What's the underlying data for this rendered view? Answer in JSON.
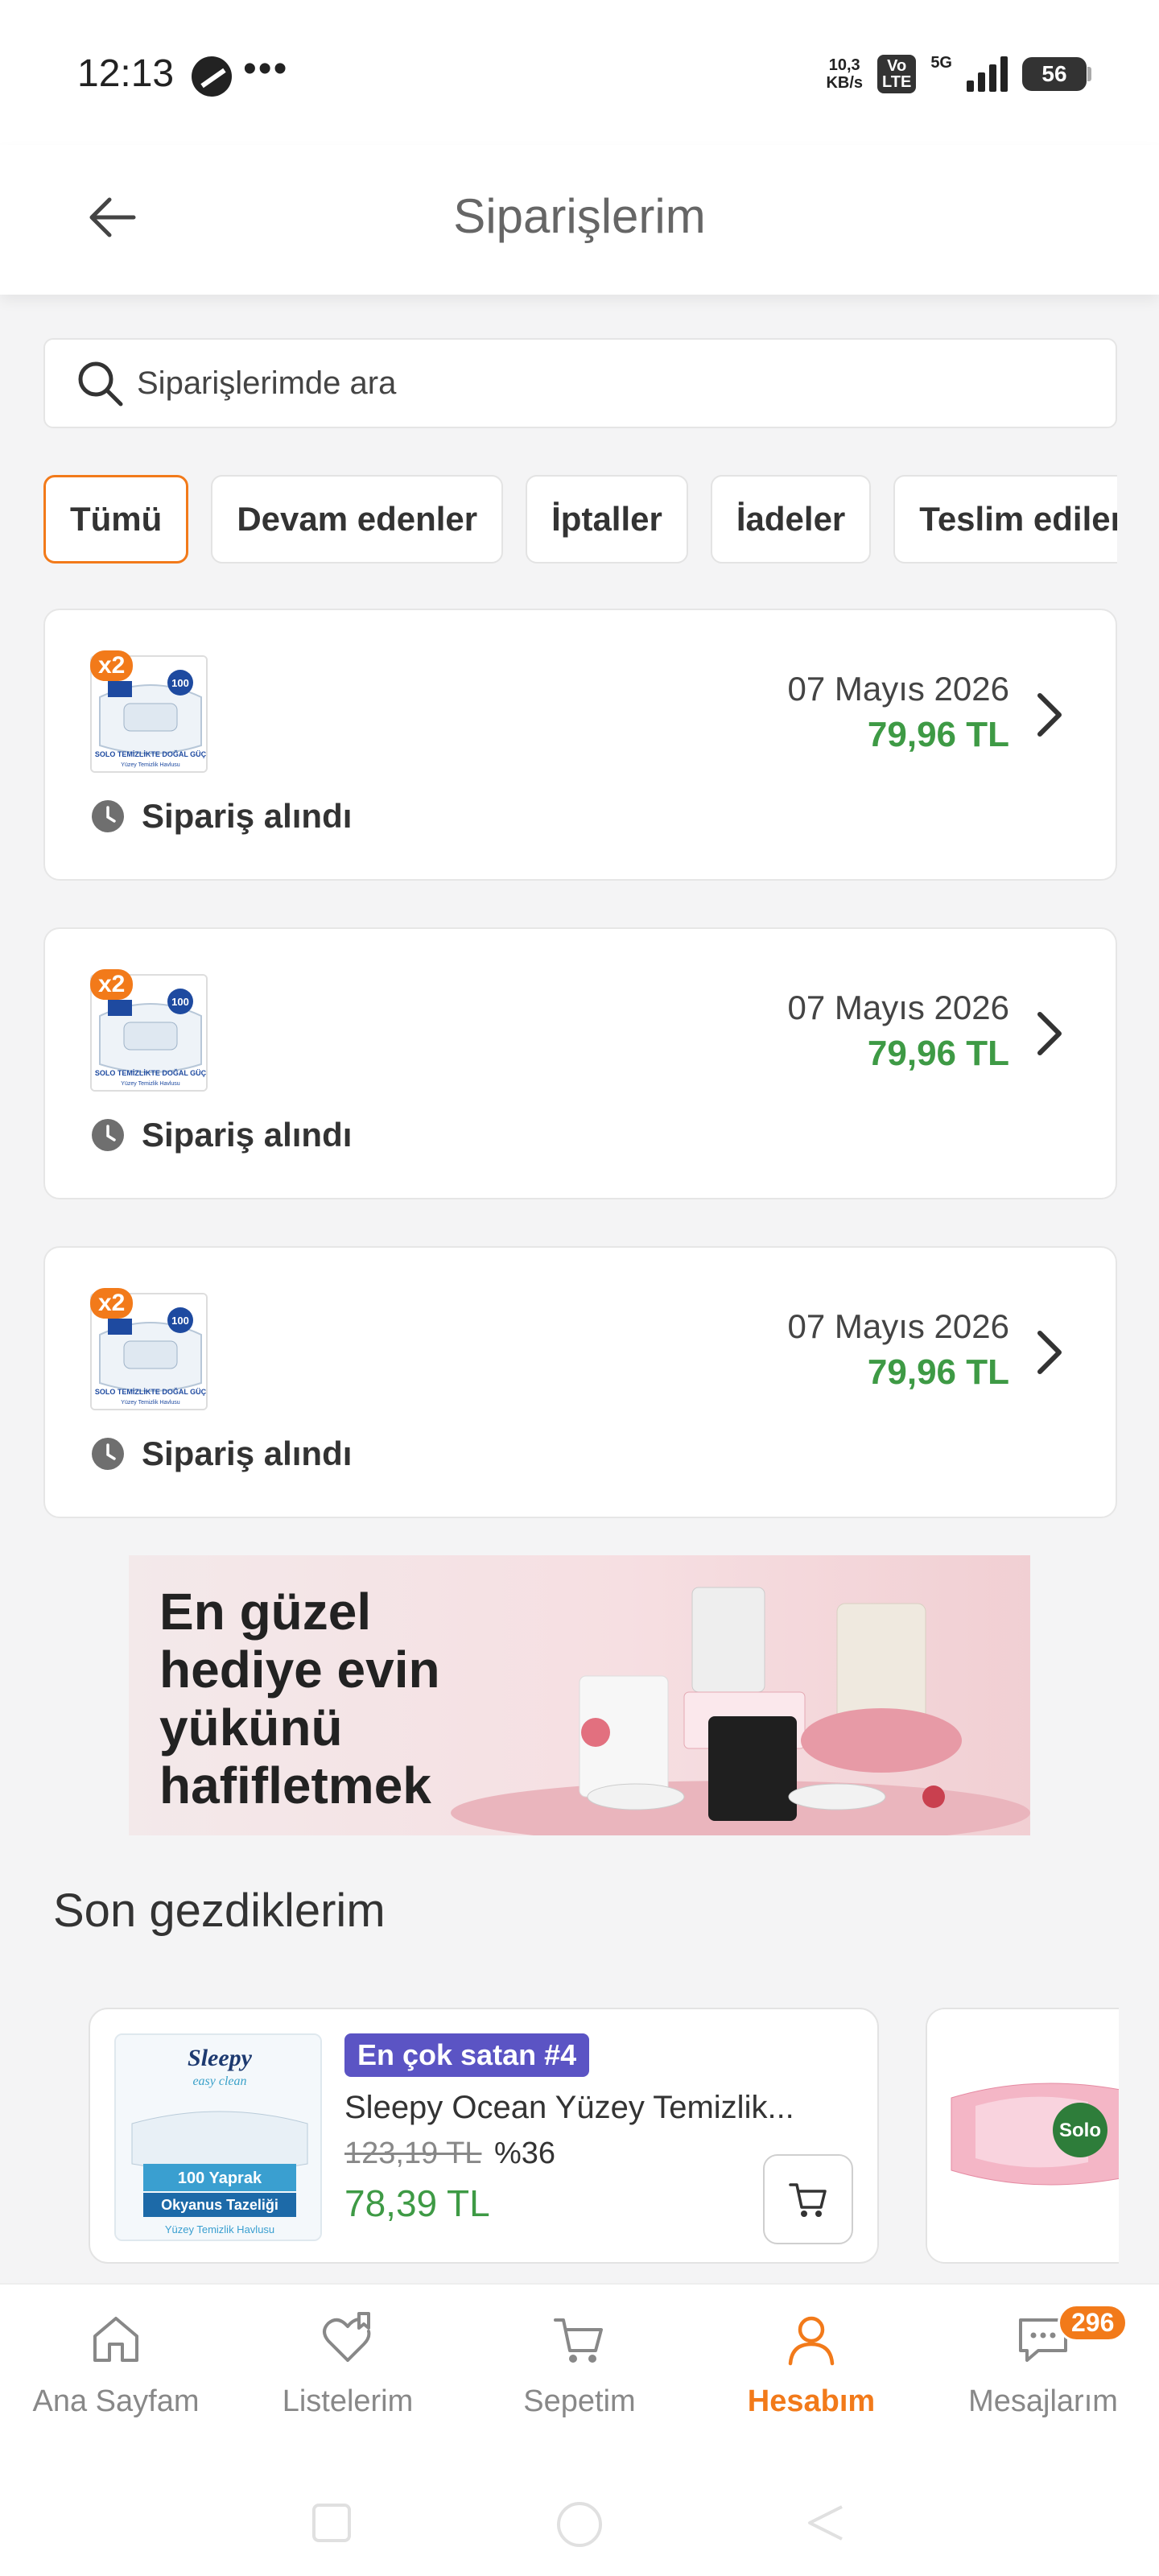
{
  "status_bar": {
    "time": "12:13",
    "dots": "•••",
    "net_speed_value": "10,3",
    "net_speed_unit": "KB/s",
    "volte_top": "Vo",
    "volte_bottom": "LTE",
    "network": "5G",
    "battery": "56"
  },
  "header": {
    "title": "Siparişlerim"
  },
  "search": {
    "placeholder": "Siparişlerimde ara"
  },
  "filters": [
    {
      "label": "Tümü",
      "active": true
    },
    {
      "label": "Devam edenler",
      "active": false
    },
    {
      "label": "İptaller",
      "active": false
    },
    {
      "label": "İadeler",
      "active": false
    },
    {
      "label": "Teslim edilemeyenler",
      "active": false
    }
  ],
  "orders": [
    {
      "qty": "x2",
      "date": "07 Mayıs 2026",
      "price": "79,96 TL",
      "status": "Sipariş alındı",
      "pack_count": "100",
      "pack_text": "SOLO TEMİZLİKTE DOĞAL GÜÇ",
      "pack_sub": "Yüzey Temizlik Havlusu"
    },
    {
      "qty": "x2",
      "date": "07 Mayıs 2026",
      "price": "79,96 TL",
      "status": "Sipariş alındı",
      "pack_count": "100",
      "pack_text": "SOLO TEMİZLİKTE DOĞAL GÜÇ",
      "pack_sub": "Yüzey Temizlik Havlusu"
    },
    {
      "qty": "x2",
      "date": "07 Mayıs 2026",
      "price": "79,96 TL",
      "status": "Sipariş alındı",
      "pack_count": "100",
      "pack_text": "SOLO TEMİZLİKTE DOĞAL GÜÇ",
      "pack_sub": "Yüzey Temizlik Havlusu"
    }
  ],
  "banner": {
    "text": "En güzel\nhediye evin\nyükünü\nhafifletmek"
  },
  "recently_viewed": {
    "title": "Son gezdiklerim",
    "items": [
      {
        "badge": "En çok satan #4",
        "name": "Sleepy Ocean Yüzey Temizlik...",
        "old_price": "123,19 TL",
        "discount": "%36",
        "price": "78,39 TL",
        "pack_brand": "Sleepy",
        "pack_sub": "easy clean",
        "pack_count": "100 Yaprak",
        "pack_scent": "Okyanus Tazeliği",
        "pack_type": "Yüzey Temizlik Havlusu"
      },
      {
        "pack_brand": "Solo"
      }
    ]
  },
  "bottom_nav": [
    {
      "label": "Ana Sayfam",
      "icon": "home-icon",
      "active": false
    },
    {
      "label": "Listelerim",
      "icon": "heart-list-icon",
      "active": false
    },
    {
      "label": "Sepetim",
      "icon": "cart-icon",
      "active": false
    },
    {
      "label": "Hesabım",
      "icon": "user-icon",
      "active": true
    },
    {
      "label": "Mesajlarım",
      "icon": "message-icon",
      "active": false,
      "badge": "296"
    }
  ],
  "colors": {
    "accent": "#f27a1a",
    "price_green": "#3e9a45",
    "badge_purple": "#5b54c4"
  }
}
